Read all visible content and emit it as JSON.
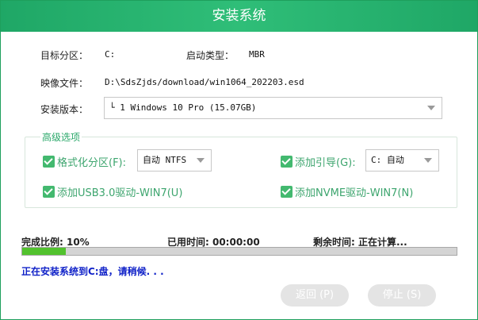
{
  "window": {
    "title": "安装系统"
  },
  "info": {
    "target_label": "目标分区：",
    "target_value": "C:",
    "boot_label": "启动类型：",
    "boot_value": "MBR",
    "image_label": "映像文件：",
    "image_value": "D:\\SdsZjds/download/win1064_202203.esd",
    "version_label": "安装版本：",
    "version_value": "└ 1 Windows 10 Pro (15.07GB)"
  },
  "advanced": {
    "title": "高级选项",
    "format_label": "格式化分区(F):",
    "format_checked": true,
    "format_value": "自动 NTFS",
    "boot_label": "添加引导(G):",
    "boot_checked": true,
    "boot_value": "C: 自动",
    "usb_label": "添加USB3.0驱动-WIN7(U)",
    "usb_checked": true,
    "nvme_label": "添加NVME驱动-WIN7(N)",
    "nvme_checked": true
  },
  "progress": {
    "ratio_text": "完成比例: 10%",
    "percent": 10,
    "elapsed_text": "已用时间: 00:00:00",
    "remaining_text": "剩余时间: 正在计算..."
  },
  "message": "正在安装系统到C:盘，请稍候. . .",
  "buttons": {
    "back_label": "返回 (P)",
    "stop_label": "停止 (S)"
  },
  "colors": {
    "title_bar": "#1fa766",
    "accent_green": "#43b96f",
    "progress_fill": "#52c22e",
    "message_blue": "#1022c8"
  },
  "icons": {
    "checkbox": "check-icon",
    "dropdown": "chevron-down-icon"
  }
}
